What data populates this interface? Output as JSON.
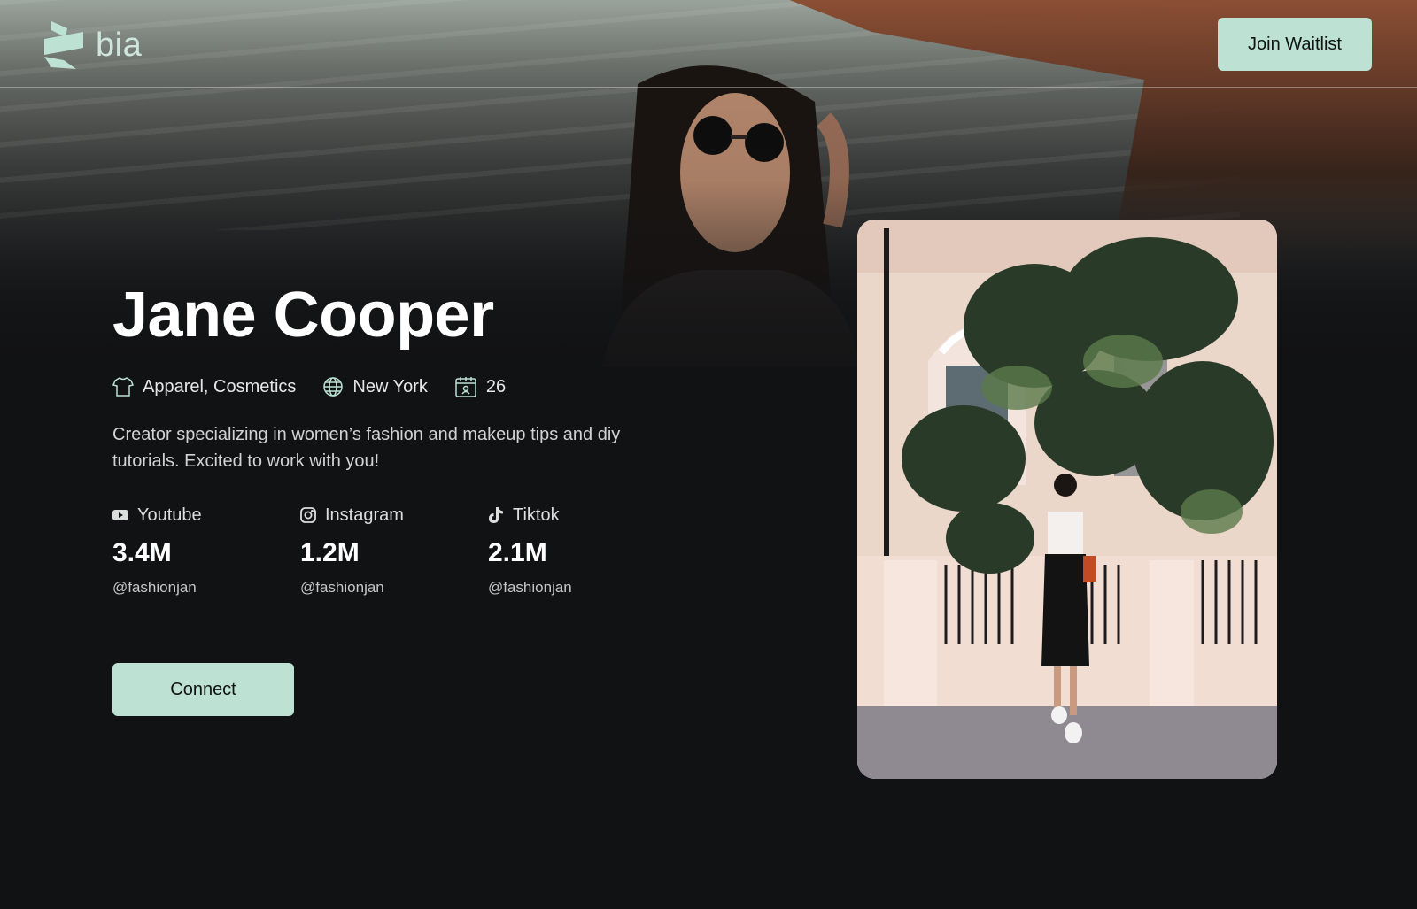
{
  "header": {
    "logo_text": "bia",
    "cta_label": "Join Waitlist"
  },
  "profile": {
    "name": "Jane Cooper",
    "meta": [
      {
        "icon": "tshirt-icon",
        "text": "Apparel, Cosmetics"
      },
      {
        "icon": "globe-icon",
        "text": "New York"
      },
      {
        "icon": "calendar-icon",
        "text": "26"
      }
    ],
    "bio": "Creator specializing in women’s fashion and makeup tips and diy tutorials. Excited to work with you!",
    "socials": [
      {
        "platform": "Youtube",
        "icon": "youtube-icon",
        "count": "3.4M",
        "handle": "@fashionjan"
      },
      {
        "platform": "Instagram",
        "icon": "instagram-icon",
        "count": "1.2M",
        "handle": "@fashionjan"
      },
      {
        "platform": "Tiktok",
        "icon": "tiktok-icon",
        "count": "2.1M",
        "handle": "@fashionjan"
      }
    ],
    "cta_label": "Connect"
  },
  "colors": {
    "background": "#111214",
    "accent": "#bde1d2",
    "logo": "#cfe6dc"
  }
}
